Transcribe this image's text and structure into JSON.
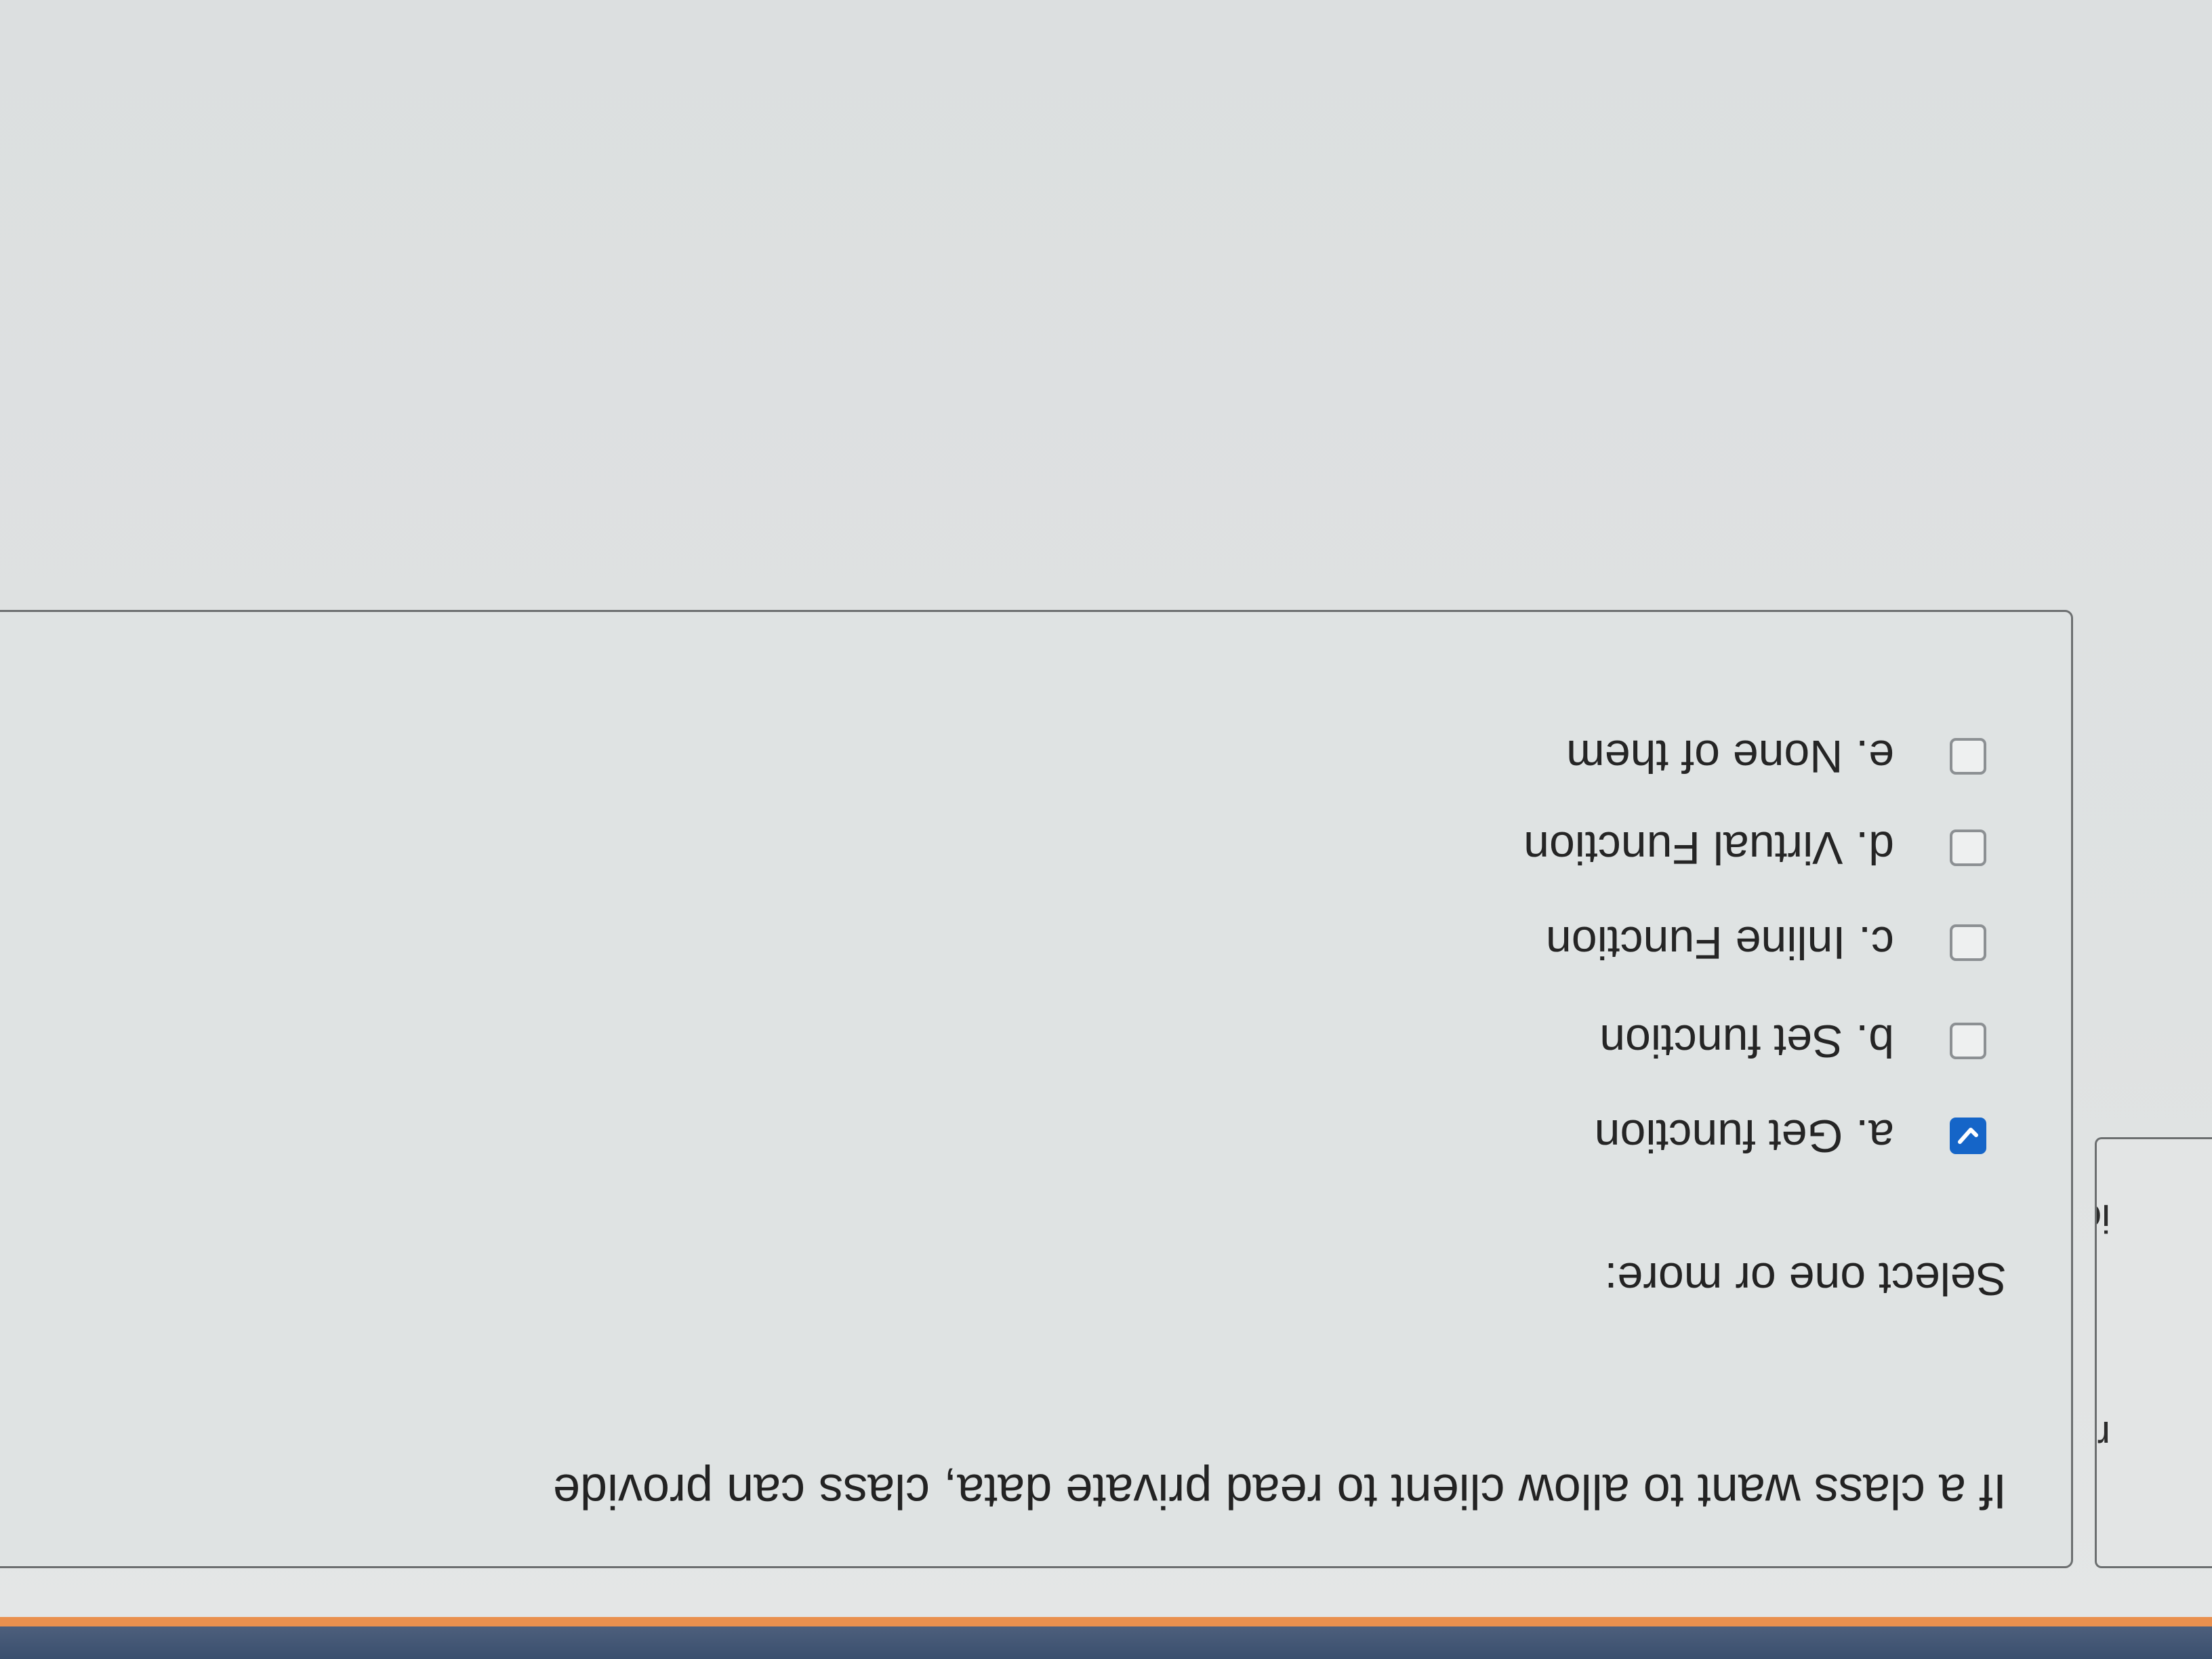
{
  "sidebar": {
    "fragment_1": "red",
    "fragment_2": "ion"
  },
  "question": {
    "text": "If a class want to allow client to read private data, class can provide",
    "prompt": "Select one or more:",
    "options": [
      {
        "label": "a. Get function",
        "checked": true
      },
      {
        "label": "b. Set function",
        "checked": false
      },
      {
        "label": "c. Inline Function",
        "checked": false
      },
      {
        "label": "d. Virtual Function",
        "checked": false
      },
      {
        "label": "e. None of them",
        "checked": false
      }
    ]
  },
  "colors": {
    "checkbox_checked": "#1565c8",
    "taskbar": "#3a4f6e",
    "accent": "#e9904e"
  }
}
